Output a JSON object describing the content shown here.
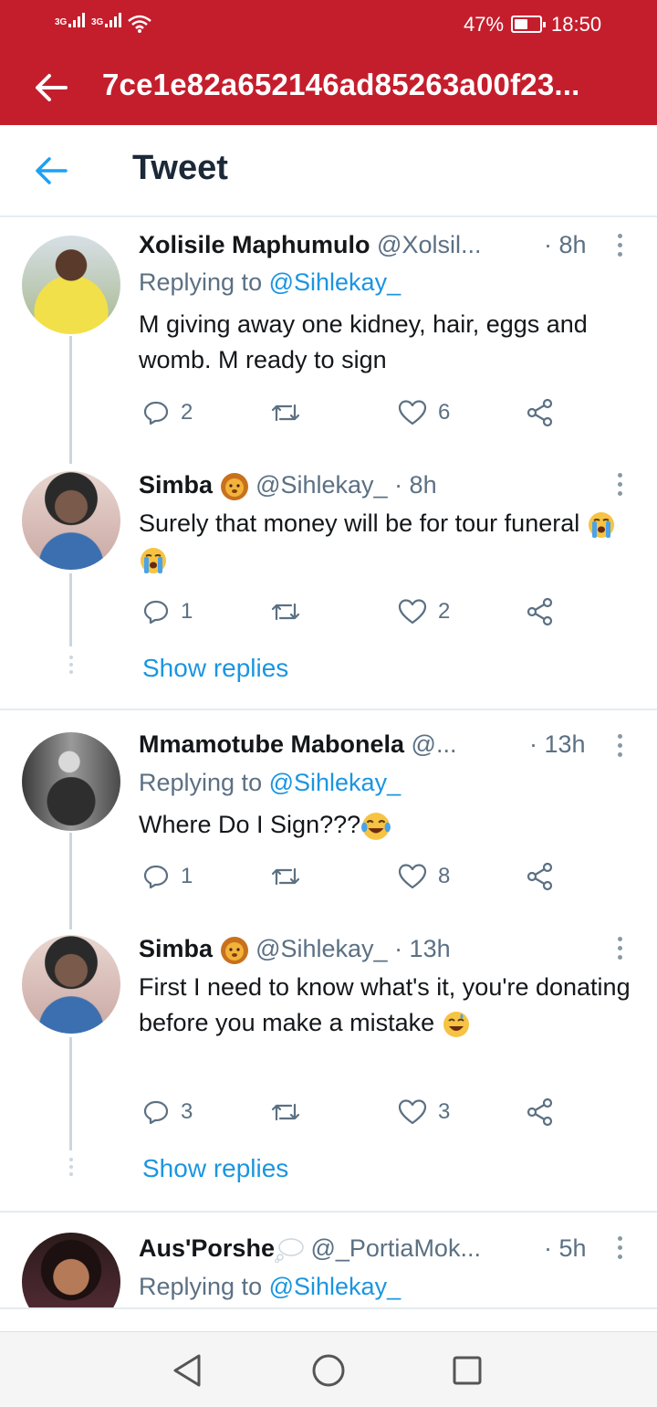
{
  "status_bar": {
    "signal1": "3G",
    "signal2": "3G",
    "battery": "47%",
    "time": "18:50"
  },
  "app_bar": {
    "title": "7ce1e82a652146ad85263a00f23..."
  },
  "tweet_header": {
    "title": "Tweet"
  },
  "threads": [
    {
      "tweets": [
        {
          "name": "Xolisile Maphumulo",
          "handle": "@Xolsil...",
          "time": "· 8h",
          "replying_prefix": "Replying to",
          "replying_to": "@Sihlekay_",
          "text": "M giving away one kidney, hair, eggs and womb. M ready to sign",
          "replies": "2",
          "likes": "6"
        },
        {
          "name": "Simba",
          "name_emoji": "lion-face",
          "handle": "@Sihlekay_",
          "time": "· 8h",
          "text": "Surely that money will be for tour funeral",
          "text_emoji": "loudly-crying-face x2",
          "replies": "1",
          "likes": "2"
        }
      ],
      "show_replies": "Show replies"
    },
    {
      "tweets": [
        {
          "name": "Mmamotube Mabonela",
          "handle": "@...",
          "time": "· 13h",
          "replying_prefix": "Replying to",
          "replying_to": "@Sihlekay_",
          "text": "Where Do I Sign???",
          "text_emoji": "tears-of-joy",
          "replies": "1",
          "likes": "8"
        },
        {
          "name": "Simba",
          "name_emoji": "lion-face",
          "handle": "@Sihlekay_",
          "time": "· 13h",
          "text": "First I need to know what's it, you're donating before you make a mistake",
          "text_emoji": "grinning-sweat",
          "replies": "3",
          "likes": "3"
        }
      ],
      "show_replies": "Show replies"
    },
    {
      "tweets": [
        {
          "name": "Aus'Porshe",
          "name_emoji": "thought-balloon",
          "handle": "@_PortiaMok...",
          "time": "· 5h",
          "replying_prefix": "Replying to",
          "replying_to": "@Sihlekay_"
        }
      ]
    }
  ],
  "colors": {
    "app_bar": "#c41e2d",
    "link": "#1b95e0",
    "muted": "#5b7083"
  }
}
